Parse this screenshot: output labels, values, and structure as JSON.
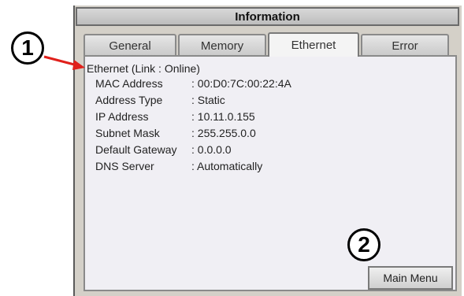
{
  "window": {
    "title": "Information"
  },
  "tabs": [
    {
      "label": "General",
      "active": false
    },
    {
      "label": "Memory",
      "active": false
    },
    {
      "label": "Ethernet",
      "active": true
    },
    {
      "label": "Error",
      "active": false
    }
  ],
  "ethernet": {
    "heading": "Ethernet (Link : Online)",
    "rows": [
      {
        "label": "MAC Address",
        "value": ": 00:D0:7C:00:22:4A"
      },
      {
        "label": "Address Type",
        "value": ": Static"
      },
      {
        "label": "IP Address",
        "value": ": 10.11.0.155"
      },
      {
        "label": "Subnet Mask",
        "value": ": 255.255.0.0"
      },
      {
        "label": "Default Gateway",
        "value": ": 0.0.0.0"
      },
      {
        "label": "DNS Server",
        "value": ": Automatically"
      }
    ]
  },
  "buttons": {
    "main_menu": "Main Menu"
  },
  "callouts": {
    "first": "1",
    "second": "2"
  },
  "colors": {
    "arrow": "#e0201b",
    "panel": "#d4d0c8",
    "content_bg": "#f0eff4"
  }
}
